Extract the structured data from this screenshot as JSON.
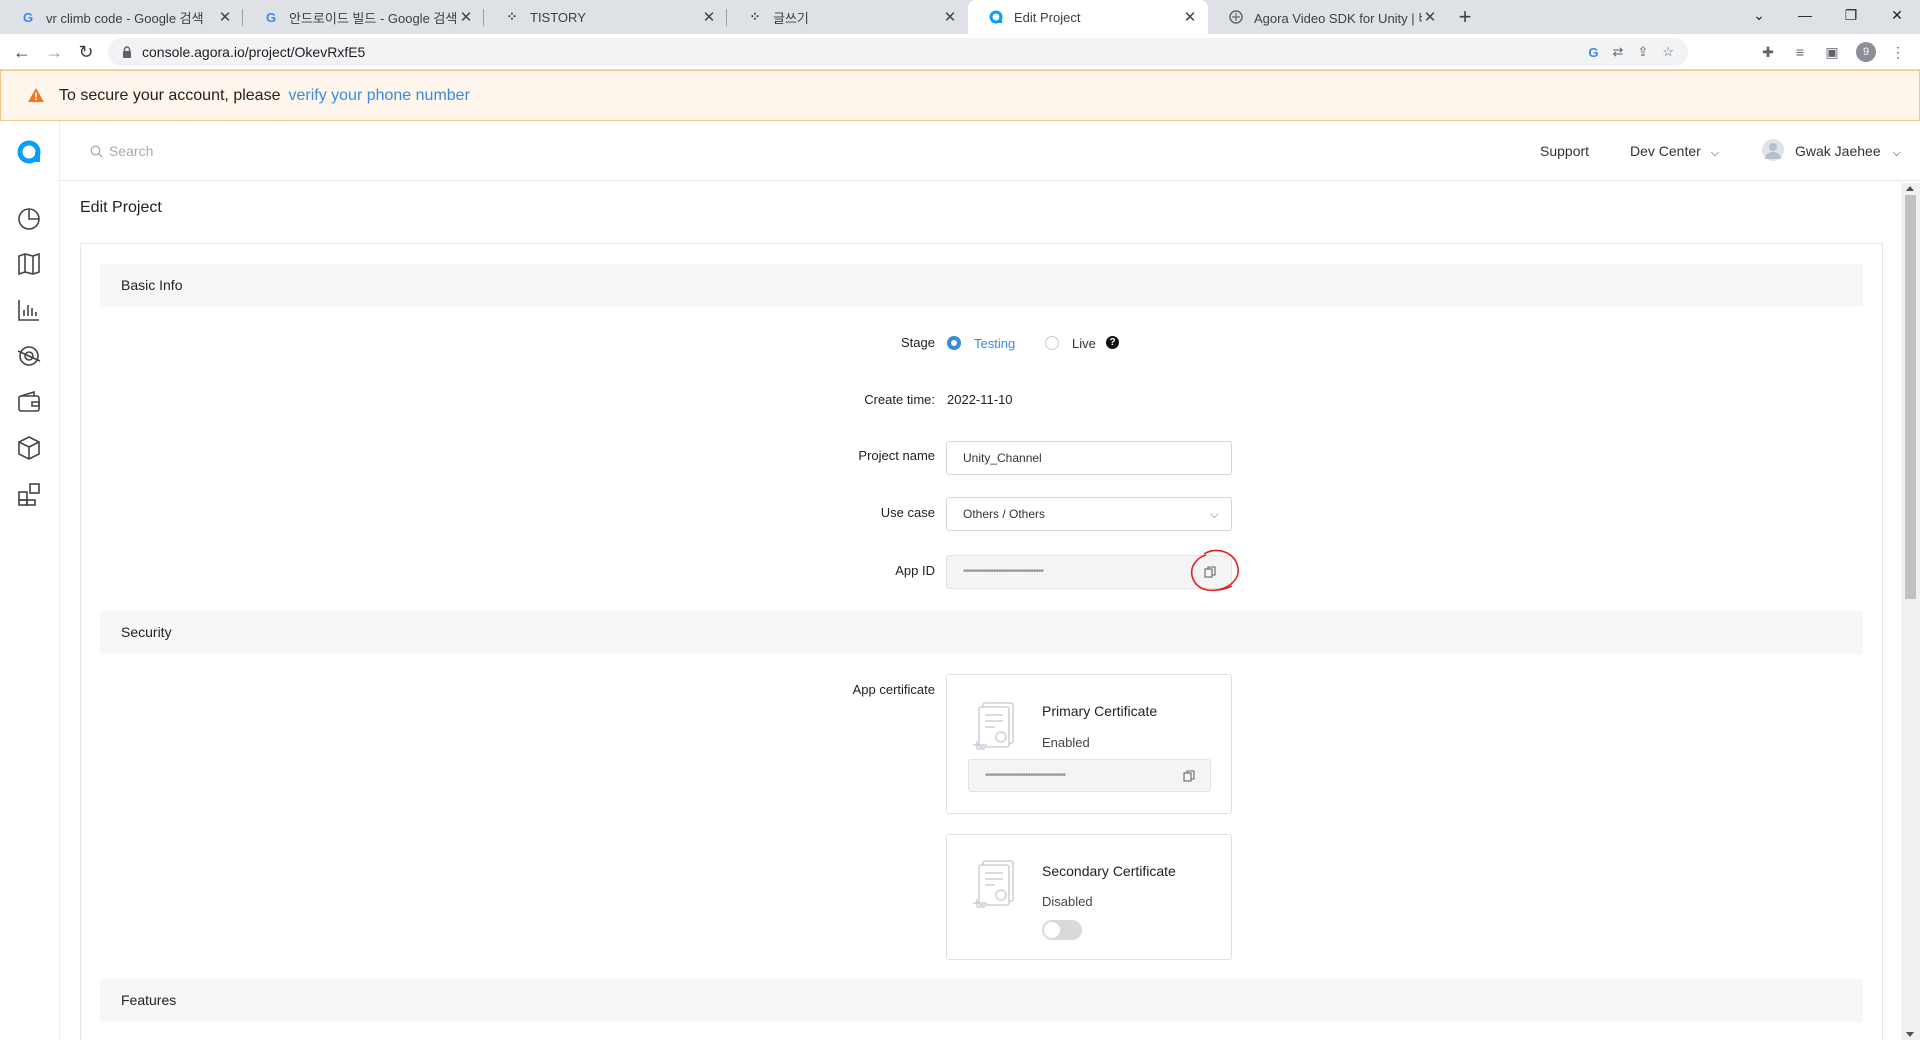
{
  "browser": {
    "tabs": [
      {
        "title": "vr climb code - Google 검색",
        "favicon": "google-icon"
      },
      {
        "title": "안드로이드 빌드 - Google 검색",
        "favicon": "google-icon"
      },
      {
        "title": "TISTORY",
        "favicon": "tistory-icon"
      },
      {
        "title": "글쓰기",
        "favicon": "tistory-icon"
      },
      {
        "title": "Edit Project",
        "favicon": "agora-icon",
        "active": true
      },
      {
        "title": "Agora Video SDK for Unity | 비디",
        "favicon": "unity-icon"
      }
    ],
    "url": "console.agora.io/project/OkevRxfE5",
    "profile_initial": "9"
  },
  "banner": {
    "text": "To secure your account, please",
    "link": "verify your phone number"
  },
  "header": {
    "search_placeholder": "Search",
    "support": "Support",
    "dev_center": "Dev Center",
    "user_name": "Gwak Jaehee"
  },
  "page": {
    "title": "Edit Project",
    "sections": {
      "basic_info": "Basic Info",
      "security": "Security",
      "features": "Features"
    },
    "stage": {
      "label": "Stage",
      "options": [
        "Testing",
        "Live"
      ],
      "selected": "Testing"
    },
    "create_time": {
      "label": "Create time:",
      "value": "2022-11-10"
    },
    "project_name": {
      "label": "Project name",
      "value": "Unity_Channel"
    },
    "use_case": {
      "label": "Use case",
      "value": "Others / Others"
    },
    "app_id": {
      "label": "App ID",
      "value": "••••••••••••••••••••••••••••••••"
    },
    "app_certificate": {
      "label": "App certificate",
      "primary": {
        "title": "Primary Certificate",
        "status": "Enabled",
        "value": "••••••••••••••••••••••••••••••••"
      },
      "secondary": {
        "title": "Secondary Certificate",
        "status": "Disabled",
        "enabled": false
      }
    }
  },
  "colors": {
    "accent": "#3a8be0",
    "agora_blue": "#099dfd",
    "annotation_red": "#e02020",
    "banner_bg": "#fef6ec"
  }
}
